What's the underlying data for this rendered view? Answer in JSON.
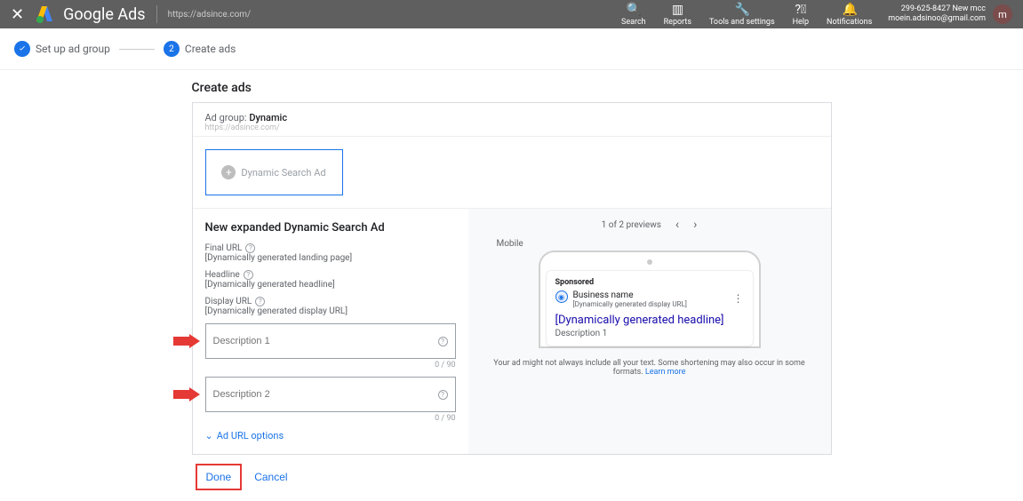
{
  "header": {
    "brand": "Google Ads",
    "url_chip": "https://adsince.com/",
    "tools": {
      "search": "Search",
      "reports": "Reports",
      "tools": "Tools and settings",
      "help": "Help",
      "notifications": "Notifications"
    },
    "account": {
      "line1": "299-625-8427 New mcc",
      "line2": "moein.adsinoo@gmail.com",
      "avatar": "m"
    }
  },
  "stepper": {
    "step1": "Set up ad group",
    "step2_num": "2",
    "step2": "Create ads"
  },
  "page_title": "Create ads",
  "ad_group": {
    "label": "Ad group:",
    "value": "Dynamic",
    "url": "https://adsince.com/"
  },
  "dsa_box": "Dynamic Search Ad",
  "editor": {
    "title": "New expanded Dynamic Search Ad",
    "final_url": {
      "label": "Final URL",
      "value": "[Dynamically generated landing page]"
    },
    "headline": {
      "label": "Headline",
      "value": "[Dynamically generated headline]"
    },
    "display_url": {
      "label": "Display URL",
      "value": "[Dynamically generated display URL]"
    },
    "desc1": {
      "placeholder": "Description 1",
      "counter": "0 / 90"
    },
    "desc2": {
      "placeholder": "Description 2",
      "counter": "0 / 90"
    },
    "url_options": "Ad URL options"
  },
  "preview": {
    "counter": "1 of 2 previews",
    "device": "Mobile",
    "sponsored": "Sponsored",
    "business": "Business name",
    "dyn_url": "[Dynamically generated display URL]",
    "headline": "[Dynamically generated headline]",
    "desc": "Description 1",
    "disclaimer": "Your ad might not always include all your text. Some shortening may also occur in some formats. ",
    "learn_more": "Learn more"
  },
  "footer": {
    "done": "Done",
    "cancel": "Cancel"
  }
}
